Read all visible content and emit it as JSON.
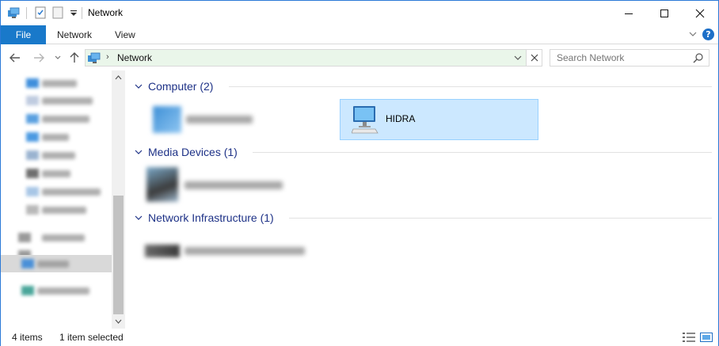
{
  "window": {
    "title": "Network",
    "accent_color": "#1979ca",
    "selection_color": "#cce8ff"
  },
  "quick_access": {
    "icons": [
      "network-folder-icon",
      "properties-icon",
      "new-folder-icon",
      "customize-dropdown-icon"
    ]
  },
  "caption_buttons": {
    "minimize": "minimize-icon",
    "maximize": "maximize-icon",
    "close": "close-icon"
  },
  "ribbon": {
    "file_label": "File",
    "tabs": [
      "Network",
      "View"
    ],
    "help_label": "?"
  },
  "navigation": {
    "back_icon": "back-arrow-icon",
    "forward_icon": "forward-arrow-icon",
    "recent_icon": "recent-locations-chevron-icon",
    "up_icon": "up-arrow-icon",
    "breadcrumb_separator": "›",
    "breadcrumb": [
      "Network"
    ],
    "search_placeholder": "Search Network"
  },
  "sidebar": {
    "items_visible": 12,
    "selected_index": 10,
    "content_obscured": true
  },
  "groups": [
    {
      "label": "Computer (2)",
      "items": [
        {
          "label": "",
          "obscured": true,
          "icon": "computer-icon"
        },
        {
          "label": "HIDRA",
          "obscured": false,
          "selected": true,
          "icon": "computer-icon"
        }
      ]
    },
    {
      "label": "Media Devices (1)",
      "items": [
        {
          "label": "",
          "obscured": true,
          "icon": "media-device-icon"
        }
      ]
    },
    {
      "label": "Network Infrastructure (1)",
      "items": [
        {
          "label": "",
          "obscured": true,
          "icon": "router-icon"
        }
      ]
    }
  ],
  "status": {
    "item_count": "4 items",
    "selection": "1 item selected"
  },
  "view_buttons": [
    "details-view-icon",
    "large-icons-view-icon"
  ]
}
